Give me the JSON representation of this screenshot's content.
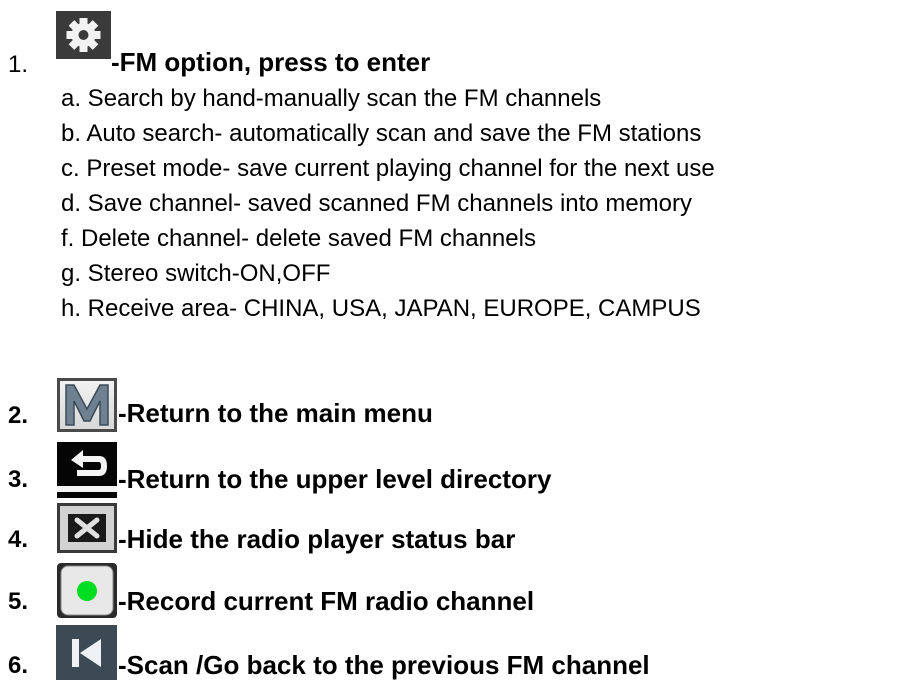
{
  "items": [
    {
      "number": "1.",
      "title": "-FM option, press to enter",
      "icon": "gear-icon",
      "subitems": [
        "a. Search by hand-manually scan the FM channels",
        "b. Auto search- automatically scan and save the FM stations",
        "c. Preset mode- save current playing channel for the next use",
        "d. Save channel- saved scanned FM channels into memory",
        "f. Delete channel- delete saved FM channels",
        "g. Stereo switch-ON,OFF",
        "h. Receive area- CHINA, USA, JAPAN, EUROPE, CAMPUS"
      ]
    },
    {
      "number": "2.",
      "title": "-Return to the main menu",
      "icon": "menu-m-icon"
    },
    {
      "number": "3.",
      "title": "-Return to the upper level directory",
      "icon": "back-arrow-icon"
    },
    {
      "number": "4.",
      "title": "-Hide the radio player status bar",
      "icon": "close-x-icon"
    },
    {
      "number": "5.",
      "title": "-Record current FM radio channel",
      "icon": "record-icon"
    },
    {
      "number": "6.",
      "title": "-Scan /Go back to the previous FM channel",
      "icon": "previous-icon"
    }
  ],
  "colors": {
    "text": "#000000",
    "record_dot": "#00dd22",
    "icon_dark": "#2a2a2a"
  }
}
